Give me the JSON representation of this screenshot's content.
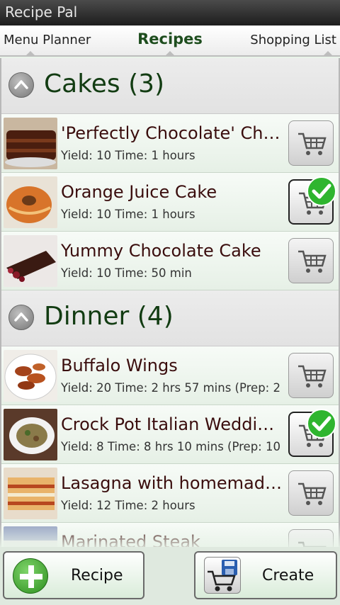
{
  "app": {
    "title": "Recipe Pal"
  },
  "tabs": {
    "left": "Menu Planner",
    "active": "Recipes",
    "right": "Shopping List"
  },
  "sections": [
    {
      "title": "Cakes (3)",
      "recipes": [
        {
          "name": "'Perfectly Chocolate' Cho...",
          "meta": "Yield: 10    Time: 1 hours",
          "in_cart": false,
          "thumb": "chocolate-cake"
        },
        {
          "name": "Orange Juice Cake",
          "meta": "Yield: 10    Time: 1 hours",
          "in_cart": true,
          "thumb": "bundt-cake"
        },
        {
          "name": "Yummy Chocolate Cake",
          "meta": "Yield: 10    Time: 50 min",
          "in_cart": false,
          "thumb": "chocolate-slice"
        }
      ]
    },
    {
      "title": "Dinner (4)",
      "recipes": [
        {
          "name": "Buffalo Wings",
          "meta": "Yield: 20    Time: 2 hrs 57 mins (Prep: 2",
          "in_cart": false,
          "thumb": "wings"
        },
        {
          "name": "Crock Pot Italian Weddin...",
          "meta": "Yield: 8    Time: 8 hrs 10 mins (Prep: 10",
          "in_cart": true,
          "thumb": "soup"
        },
        {
          "name": "Lasagna with homemade...",
          "meta": "Yield: 12    Time: 2 hours",
          "in_cart": false,
          "thumb": "lasagna"
        },
        {
          "name": "Marinated Steak",
          "meta": "",
          "in_cart": false,
          "thumb": "steak"
        }
      ]
    }
  ],
  "bottom": {
    "recipe_label": "Recipe",
    "create_label": "Create"
  },
  "icons": {
    "collapse": "chevron-up-icon",
    "cart": "shopping-cart-icon",
    "check": "checkmark-icon",
    "add": "plus-icon",
    "create": "cart-save-icon"
  },
  "colors": {
    "title_bar": "#2a2a2a",
    "section_title": "#123c12",
    "recipe_name": "#3a0d0d",
    "row_bg": "#eef5ee",
    "check_green": "#2fb52f"
  }
}
